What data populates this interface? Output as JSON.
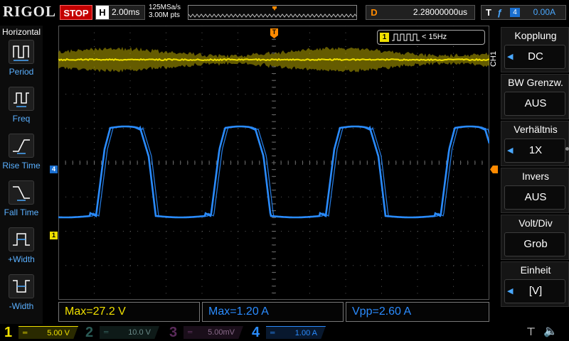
{
  "topbar": {
    "brand": "RIGOL",
    "run_state": "STOP",
    "h_label": "H",
    "timebase": "2.00ms",
    "sample_rate": "125MSa/s",
    "mem_depth": "3.00M pts",
    "delay_label": "D",
    "delay_value": "2.28000000us",
    "trigger_label": "T",
    "trigger_edge": "ƒ",
    "trigger_source": "4",
    "trigger_level": "0.00A"
  },
  "left_menu": {
    "title": "Horizontal",
    "items": [
      {
        "label": "Period",
        "icon": "period-icon"
      },
      {
        "label": "Freq",
        "icon": "frequency-icon"
      },
      {
        "label": "Rise Time",
        "icon": "rise-time-icon"
      },
      {
        "label": "Fall Time",
        "icon": "fall-time-icon"
      },
      {
        "label": "+Width",
        "icon": "positive-width-icon"
      },
      {
        "label": "-Width",
        "icon": "negative-width-icon"
      }
    ]
  },
  "screen": {
    "ch4_marker": "4",
    "ch1_marker": "1",
    "trigger_marker": "T",
    "freq_counter": {
      "channel": "1",
      "value": "< 15Hz"
    }
  },
  "measurements": [
    {
      "text": "Max=27.2 V",
      "color": "#f0e000"
    },
    {
      "text": "Max=1.20 A",
      "color": "#2a8cff"
    },
    {
      "text": "Vpp=2.60 A",
      "color": "#2a8cff"
    }
  ],
  "right_menu": {
    "channel_tag": "CH1",
    "items": [
      {
        "title": "Kopplung",
        "value": "DC",
        "has_arrow": true
      },
      {
        "title": "BW Grenzw.",
        "value": "AUS",
        "has_arrow": false
      },
      {
        "title": "Verhältnis",
        "value": "1X",
        "has_arrow": true
      },
      {
        "title": "Invers",
        "value": "AUS",
        "has_arrow": false
      },
      {
        "title": "Volt/Div",
        "value": "Grob",
        "has_arrow": false
      },
      {
        "title": "Einheit",
        "value": "[V]",
        "has_arrow": true
      }
    ]
  },
  "channels": [
    {
      "number": "1",
      "coupling": "═",
      "scale": "5.00 V",
      "color": "#f0e000",
      "active": true
    },
    {
      "number": "2",
      "coupling": "═",
      "scale": "10.0 V",
      "color": "#00b0a0",
      "active": false
    },
    {
      "number": "3",
      "coupling": "═",
      "scale": "5.00mV",
      "color": "#c020c0",
      "active": false
    },
    {
      "number": "4",
      "coupling": "═",
      "scale": "1.00 A",
      "color": "#2a8cff",
      "active": true
    }
  ],
  "colors": {
    "ch1": "#f0e000",
    "ch4": "#2a8cff",
    "trigger": "#ff8a00",
    "stop": "#c40000"
  }
}
